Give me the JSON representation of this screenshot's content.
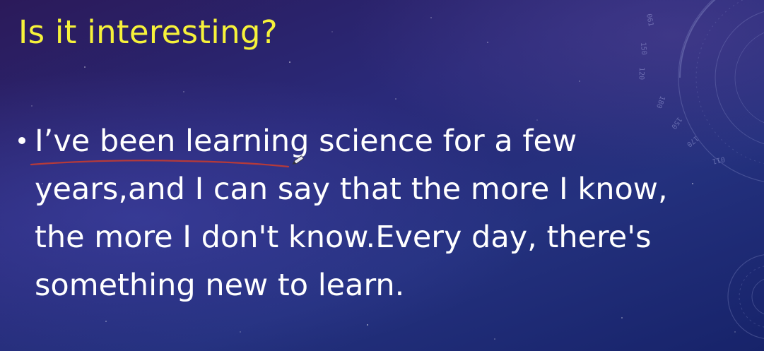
{
  "slide": {
    "title": "Is it interesting?",
    "bullet": {
      "lines": [
        "I’ve been learning science for a few",
        "years,and I can say that the more I know,",
        "the more I don't know.Every day, there's",
        "something new to learn."
      ]
    },
    "decoration_ticks": [
      "061",
      "150",
      "120",
      "180",
      "150",
      "170",
      "011"
    ]
  },
  "colors": {
    "title": "#f6f23a",
    "body_text": "#ffffff",
    "ink_underline": "#b53a3a",
    "background_deep": "#17236a",
    "background_purple": "#2b1a5a"
  },
  "icons": {
    "bullet": "bullet-dot-icon",
    "cursor": "pen-cursor-icon"
  }
}
